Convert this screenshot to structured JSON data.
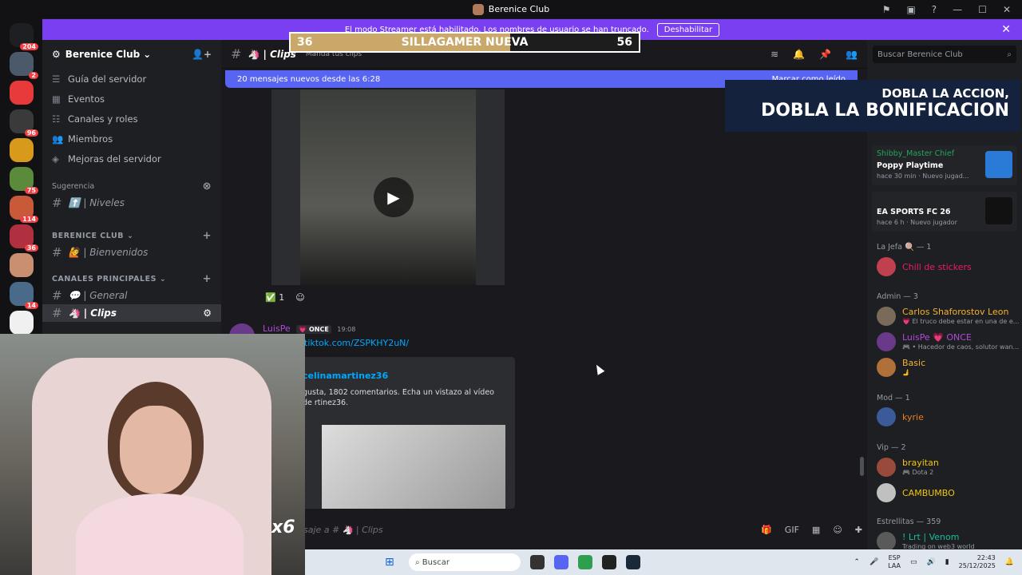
{
  "window": {
    "title": "Berenice Club"
  },
  "streamer_banner": {
    "text": "El modo Streamer está habilitado. Los nombres de usuario se han truncado.",
    "button": "Deshabilitar"
  },
  "overlay_bar": {
    "left": "36",
    "center": "SILLAGAMER NUEVA",
    "right": "56",
    "progress": 0.63
  },
  "servers": [
    {
      "icon": "discord-home-icon",
      "badge": "204",
      "color": "#1e1f22"
    },
    {
      "icon": "server-avatar",
      "badge": "2",
      "color": "#4a5a6a"
    },
    {
      "icon": "server-avatar",
      "badge": "",
      "color": "#e83a3a"
    },
    {
      "icon": "server-avatar",
      "badge": "96",
      "color": "#3a3a3a"
    },
    {
      "icon": "server-avatar",
      "badge": "",
      "color": "#d89a1a"
    },
    {
      "icon": "server-avatar",
      "badge": "75",
      "color": "#5a8a3a"
    },
    {
      "icon": "server-avatar",
      "badge": "114",
      "color": "#c85a3a"
    },
    {
      "icon": "server-avatar",
      "badge": "36",
      "color": "#b03040"
    },
    {
      "icon": "server-avatar",
      "badge": "",
      "color": "#c89070"
    },
    {
      "icon": "server-avatar",
      "badge": "14",
      "color": "#4a6a8a"
    },
    {
      "icon": "server-avatar",
      "badge": "",
      "color": "#f0f0f0"
    }
  ],
  "sidebar": {
    "server_name": "Berenice Club",
    "menu": [
      {
        "icon": "guide-icon",
        "label": "Guía del servidor"
      },
      {
        "icon": "calendar-icon",
        "label": "Eventos"
      },
      {
        "icon": "channels-roles-icon",
        "label": "Canales y roles"
      },
      {
        "icon": "members-icon",
        "label": "Miembros"
      },
      {
        "icon": "boost-icon",
        "label": "Mejoras del servidor"
      }
    ],
    "suggestion_label": "Sugerencia",
    "suggestion_channel": "⬆️ | Niveles",
    "cat1": "BERENICE CLUB",
    "cat1_channel": "🙋 | Bienvenidos",
    "cat2": "CANALES PRINCIPALES",
    "cat2_ch1": "💬 | General",
    "cat2_ch2": "🦄 | Clips"
  },
  "channel": {
    "name": "🦄 | Clips",
    "topic": "Manda tus clips"
  },
  "new_messages": {
    "text": "20 mensajes nuevos desde las 6:28",
    "mark": "Marcar como leído"
  },
  "reaction": {
    "emoji": "✅",
    "count": "1"
  },
  "message": {
    "author": "LuisPe",
    "tag": "💗 ONCE",
    "time": "19:08",
    "link": "tiktok.com/ZSPKHY2uN/",
    "embed_author": "celinamartinez36",
    "embed_desc": "gusta, 1802 comentarios. Echa un vistazo al vídeo de rtinez36."
  },
  "composer": {
    "placeholder": "saje a # 🦄 | Clips"
  },
  "search": {
    "placeholder": "Buscar Berenice Club"
  },
  "promo": {
    "line1": "DOBLA LA ACCION,",
    "line2": "DOBLA LA BONIFICACION"
  },
  "activities": [
    {
      "who": "Shibby_Master Chief",
      "game": "Poppy Playtime",
      "meta": "hace 30 min · Nuevo jugad...",
      "color": "#2a7ad8"
    },
    {
      "who": "",
      "game": "EA SPORTS FC 26",
      "meta": "hace 6 h · Nuevo jugador",
      "color": "#111"
    }
  ],
  "members": {
    "la_jefa_label": "La Jefa 🍭 — 1",
    "la_jefa": [
      {
        "name": "Chill de stickers",
        "status": "",
        "color": "#e91e63",
        "av": "#c04050"
      }
    ],
    "admin_label": "Admin — 3",
    "admin": [
      {
        "name": "Carlos Shaforostov Leon",
        "status": "💗 El truco debe estar en una de e...",
        "color": "#f0b232",
        "av": "#7a6a5a"
      },
      {
        "name": "LuisPe 💗 ONCE",
        "status": "🎮 • Hacedor de caos, solutor wan...",
        "color": "#b04bd8",
        "av": "#6a3a8a"
      },
      {
        "name": "Basic",
        "status": "🫸",
        "color": "#f0b232",
        "av": "#b0703a"
      }
    ],
    "mod_label": "Mod — 1",
    "mod": [
      {
        "name": "kyrie",
        "status": "",
        "color": "#e67e22",
        "av": "#3a5a9a"
      }
    ],
    "vip_label": "Vip — 2",
    "vip": [
      {
        "name": "brayitan",
        "status": "🎮 Dota 2",
        "color": "#f1c40f",
        "av": "#9a4a3a"
      },
      {
        "name": "CAMBUMBO",
        "status": "",
        "color": "#f1c40f",
        "av": "#c0c0c0"
      }
    ],
    "stars_label": "Estrellitas — 359",
    "stars": [
      {
        "name": "! Lrt | Venom",
        "status": "Trading on web3 world",
        "color": "#1abc9c",
        "av": "#5a5a5a"
      }
    ]
  },
  "webcam": {
    "multiplier": "x6"
  },
  "taskbar": {
    "search": "Buscar",
    "lang1": "ESP",
    "lang2": "LAA",
    "time": "22:43",
    "date": "25/12/2025"
  }
}
